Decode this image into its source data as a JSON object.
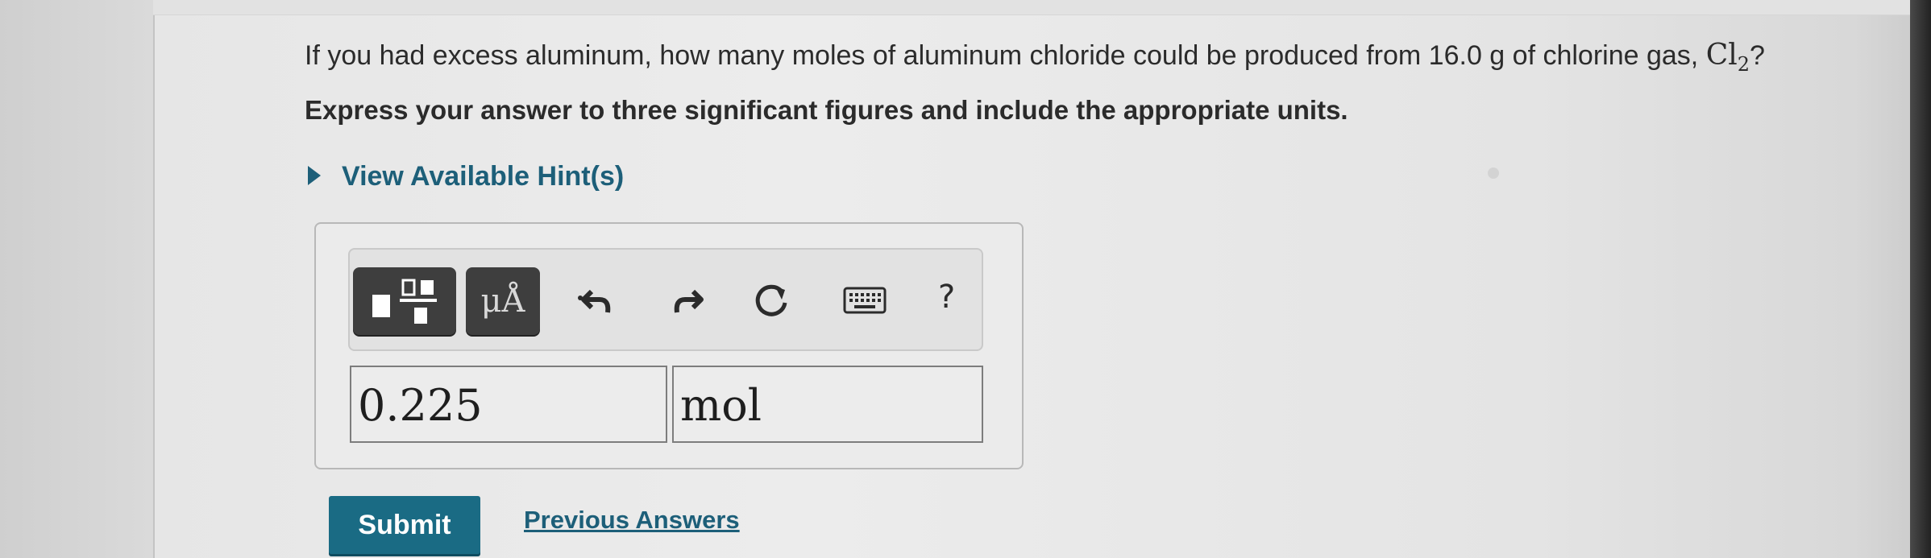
{
  "question": {
    "text": "If you had excess aluminum, how many moles of aluminum chloride could be produced from 16.0 g of chlorine gas, ",
    "formula_base": "Cl",
    "formula_sub": "2",
    "suffix": "?"
  },
  "instruction": "Express your answer to three significant figures and include the appropriate units.",
  "hints_label": "View Available Hint(s)",
  "toolbar": {
    "units_label": "μÅ",
    "help_label": "?"
  },
  "answer": {
    "value": "0.225",
    "units": "mol"
  },
  "actions": {
    "submit_label": "Submit",
    "previous_answers_label": "Previous Answers"
  },
  "colors": {
    "link": "#1d5f79",
    "submit_bg": "#1a6b84"
  },
  "icons": [
    "templates-icon",
    "undo-icon",
    "redo-icon",
    "reset-icon",
    "keyboard-icon",
    "help-icon"
  ]
}
